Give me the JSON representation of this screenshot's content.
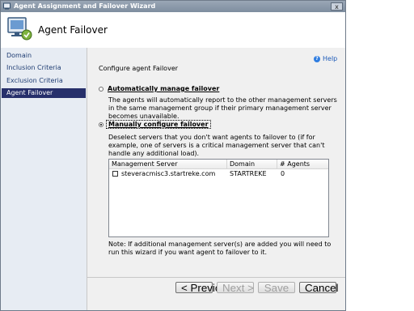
{
  "window": {
    "title": "Agent Assignment and Failover Wizard",
    "close_glyph": "x"
  },
  "header": {
    "title": "Agent Failover",
    "icon": "wizard-icon"
  },
  "sidebar": {
    "items": [
      {
        "label": "Domain",
        "active": false
      },
      {
        "label": "Inclusion Criteria",
        "active": false
      },
      {
        "label": "Exclusion Criteria",
        "active": false
      },
      {
        "label": "Agent Failover",
        "active": true
      }
    ]
  },
  "main": {
    "help_label": "Help",
    "help_glyph": "?",
    "section_title": "Configure agent Failover",
    "option_auto": {
      "label": "Automatically manage failover",
      "selected": false,
      "description": "The agents will automatically report to the other management servers in the same management group if their primary management server becomes unavailable."
    },
    "option_manual": {
      "label": "Manually configure failover",
      "selected": true,
      "description": "Deselect servers that you don't want agents to failover to (if for example, one of servers is a critical management server that can't handle any additional load)."
    },
    "table": {
      "columns": [
        "Management Server",
        "Domain",
        "# Agents"
      ],
      "rows": [
        {
          "server": "steveracmisc3.startreke.com",
          "domain": "STARTREKE",
          "agents": "0",
          "checked": false
        }
      ]
    },
    "note": "Note: If additional management server(s) are added you will need to run this wizard if you want agent to failover to it."
  },
  "footer": {
    "previous": "< Previous",
    "next": "Next >",
    "save": "Save",
    "cancel": "Cancel"
  },
  "colors": {
    "title_bar": "#8896a8",
    "sidebar_bg": "#e7ecf3",
    "sidebar_active": "#27306b",
    "link": "#1d5bb8"
  }
}
